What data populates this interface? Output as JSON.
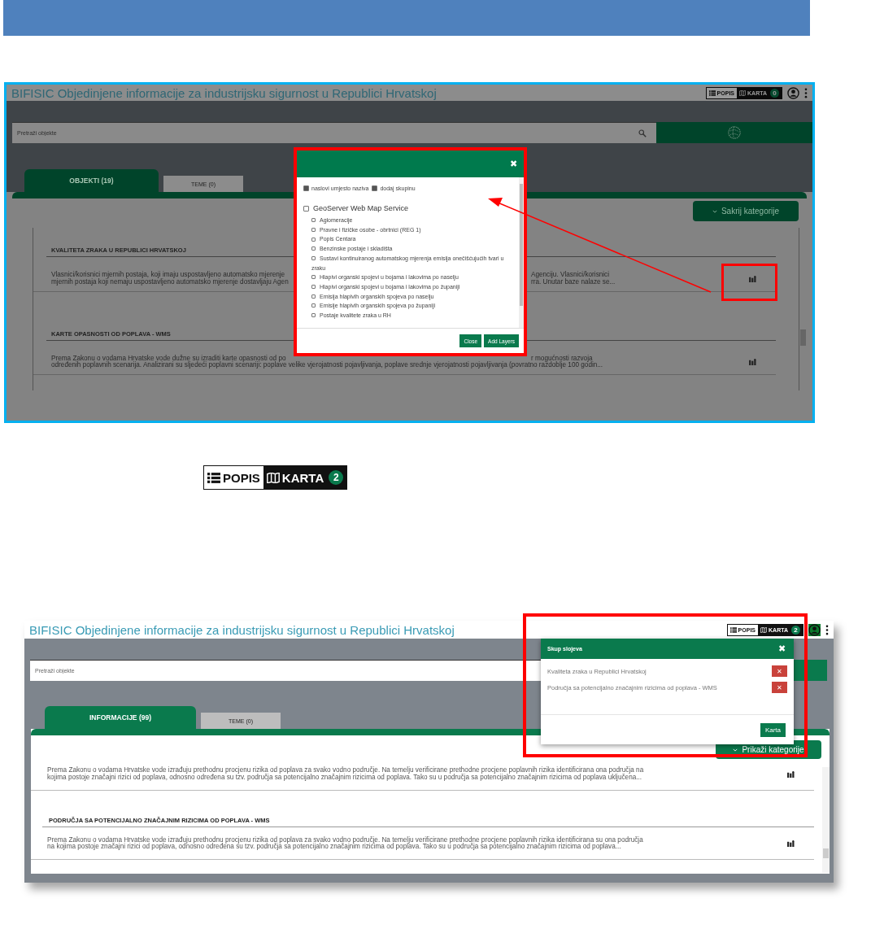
{
  "screen_1": {
    "app_title": "BIFISIC Objedinjene informacije za industrijsku sigurnost u Republici Hrvatskoj",
    "view_switch": {
      "list_label": "POPIS",
      "map_label": "KARTA",
      "map_count": "0"
    },
    "search": {
      "placeholder": "Pretraži objekte"
    },
    "tabs": [
      {
        "label": "OBJEKTI (19)",
        "selected": true
      },
      {
        "label": "TEME (0)",
        "selected": false
      }
    ],
    "toggle_button": "Sakrij kategorije",
    "sections": [
      {
        "title": "KVALITETA ZRAKA U REPUBLICI HRVATSKOJ",
        "lines": [
          {
            "text": "Vlasnici/korisnici mjernih postaja, koji imaju uspostavljeno automatsko mjerenje",
            "after_gap": "Agenciju. Vlasnici/korisnici"
          },
          {
            "text": "mjernih postaja koji nemaju uspostavljeno automatsko mjerenje dostavljaju Agen",
            "after_gap": "rra. Unutar baze nalaze se..."
          }
        ]
      },
      {
        "title": "KARTE OPASNOSTI OD POPLAVA - WMS",
        "lines": [
          {
            "text": "Prema Zakonu o vodama Hrvatske vode dužne su izraditi karte opasnosti od po",
            "after_gap": "r mogućnosti razvoja"
          },
          {
            "text": "određenih poplavnih scenarija. Analizirani su sljedeći poplavni scenariji: poplave velike vjerojatnosti pojavljivanja, poplave srednje vjerojatnosti pojavljivanja (povratno razdoblje 100 godin..."
          }
        ]
      }
    ],
    "modal": {
      "close": "✖",
      "options": [
        {
          "label": "naslovi umjesto naziva",
          "checked": true
        },
        {
          "label": "dodaj skupinu",
          "checked": true
        }
      ],
      "group": {
        "label": "GeoServer Web Map Service",
        "checked": false
      },
      "layers": [
        {
          "label": "Aglomeracije",
          "checked": false
        },
        {
          "label": "Pravne i fizičke osobe - obrtnici (REG 1)",
          "checked": false
        },
        {
          "label": "Popis Centara",
          "checked": false
        },
        {
          "label": "Benzinske postaje i skladišta",
          "checked": false
        },
        {
          "label": "Sustavi kontinuiranog automatskog mjerenja emisija onečišćujućih tvari u zraku",
          "checked": false
        },
        {
          "label": "Hlapivi organski spojevi u bojama i lakovima po naselju",
          "checked": false
        },
        {
          "label": "Hlapivi organski spojevi u bojama i lakovima po županiji",
          "checked": false
        },
        {
          "label": "Emisija hlapivih organskih spojeva po naselju",
          "checked": false
        },
        {
          "label": "Emisije hlapivih organskih spojeva po županiji",
          "checked": false
        },
        {
          "label": "Postaje kvalitete zraka u RH",
          "checked": false
        }
      ],
      "buttons": [
        "Close",
        "Add Layers"
      ]
    }
  },
  "view_switch_closeup": {
    "list_label": "POPIS",
    "map_label": "KARTA",
    "map_count": "2"
  },
  "screen_2": {
    "app_title": "BIFISIC Objedinjene informacije za industrijsku sigurnost u Republici Hrvatskoj",
    "view_switch": {
      "list_label": "POPIS",
      "map_label": "KARTA",
      "map_count": "2"
    },
    "search": {
      "placeholder": "Pretraži objekte"
    },
    "tabs": [
      {
        "label": "INFORMACIJE (99)",
        "selected": true
      },
      {
        "label": "TEME (0)",
        "selected": false
      }
    ],
    "toggle_button": "Prikaži kategorije",
    "sections": [
      {
        "lines": [
          {
            "text": "Prema Zakonu o vodama Hrvatske vode izrađuju prethodnu procjenu rizika od poplava za svako vodno područje. Na temelju verificirane prethodne procjene poplavnih rizika identificirana ona područja na"
          },
          {
            "text": "kojima postoje značajni rizici od poplava, odnosno određena su tzv. područja sa potencijalno značajnim rizicima od poplava. Tako su u područja sa potencijalno značajnim rizicima od poplava uključena..."
          }
        ]
      },
      {
        "title": "PODRUČJA SA POTENCIJALNO ZNAČAJNIM RIZICIMA OD POPLAVA - WMS",
        "lines": [
          {
            "text": "Prema Zakonu o vodama Hrvatske vode izrađuju prethodnu procjenu rizika od poplava za svako vodno područje. Na temelju verificirane prethodne procjene poplavnih rizika identificirana su ona područja"
          },
          {
            "text": "na kojima postoje značajni rizici od poplava, odnosno određena su tzv. područja sa potencijalno značajnim rizicima od poplava. Tako su u područja sa potencijalno značajnim rizicima od poplava..."
          }
        ]
      }
    ],
    "popup": {
      "title": "Skup slojeva",
      "close": "✖",
      "items": [
        {
          "label": "Kvaliteta zraka u Republici Hrvatskoj",
          "remove": "✕"
        },
        {
          "label": "Područja sa potencijalno značajnim rizicima od poplava - WMS",
          "remove": "✕"
        }
      ],
      "button": "Karta"
    }
  }
}
